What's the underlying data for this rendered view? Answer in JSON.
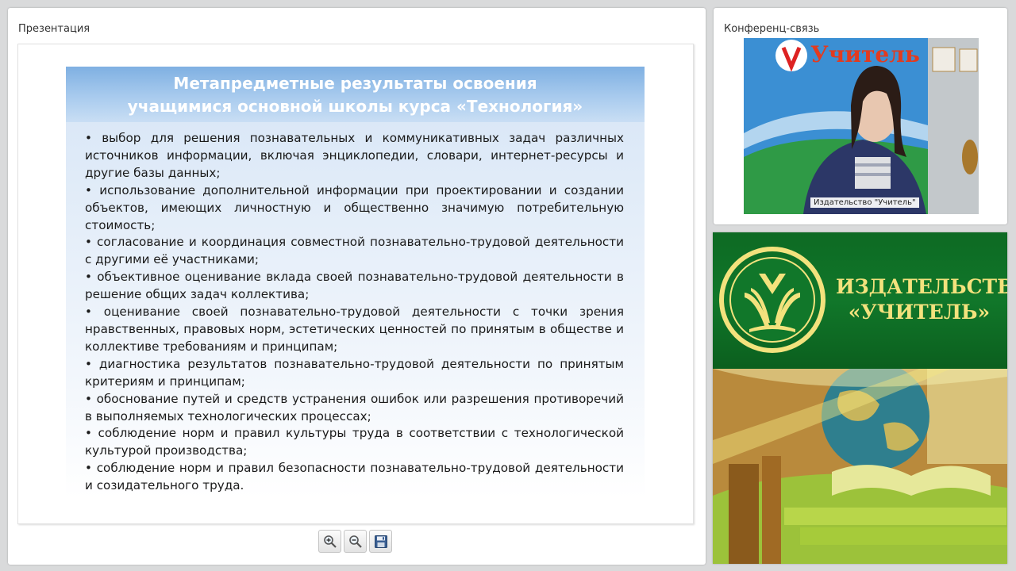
{
  "presentation": {
    "title": "Презентация",
    "slide": {
      "header_line1": "Метапредметные результаты  освоения",
      "header_line2": "учащимися основной школы курса «Технология»",
      "items": [
        "• выбор для решения познавательных и коммуникативных задач различных источников информации, включая энциклопедии, словари, интернет-ресурсы и другие базы данных;",
        "• использование дополнительной информации при проектировании и создании объектов, имеющих личностную и общественно значимую потребительную стоимость;",
        "• согласование и координация совместной познавательно-трудовой деятельности с другими её участниками;",
        "• объективное оценивание вклада своей познавательно-трудовой деятельности в решение общих задач коллектива;",
        "• оценивание своей познавательно-трудовой деятельности с точки зрения нравственных, правовых норм, эстетических ценностей по принятым в обществе и коллективе требованиям и принципам;",
        "• диагностика результатов познавательно-трудовой деятельности по принятым критериям и принципам;",
        "• обоснование путей и средств устранения ошибок или разрешения противоречий в выполняемых технологических процессах;",
        "• соблюдение норм и правил культуры труда в соответствии с технологической культурой производства;",
        "• соблюдение норм и правил безопасности познавательно-трудовой деятельности и созидательного труда."
      ]
    },
    "toolbar": {
      "zoom_in_icon": "zoom-in-icon",
      "zoom_out_icon": "zoom-out-icon",
      "save_icon": "save-icon"
    }
  },
  "conference": {
    "title": "Конференц-связь",
    "video_caption": "Издательство \"Учитель\"",
    "banner_text": "Учитель"
  },
  "publisher": {
    "line1": "ИЗДАТЕЛЬСТВО",
    "line2": "«УЧИТЕЛЬ»"
  },
  "colors": {
    "page_bg": "#d9dadb",
    "slide_header_blue": "#7fb0e2",
    "publisher_green": "#11772a",
    "publisher_gold": "#f3e27d"
  }
}
